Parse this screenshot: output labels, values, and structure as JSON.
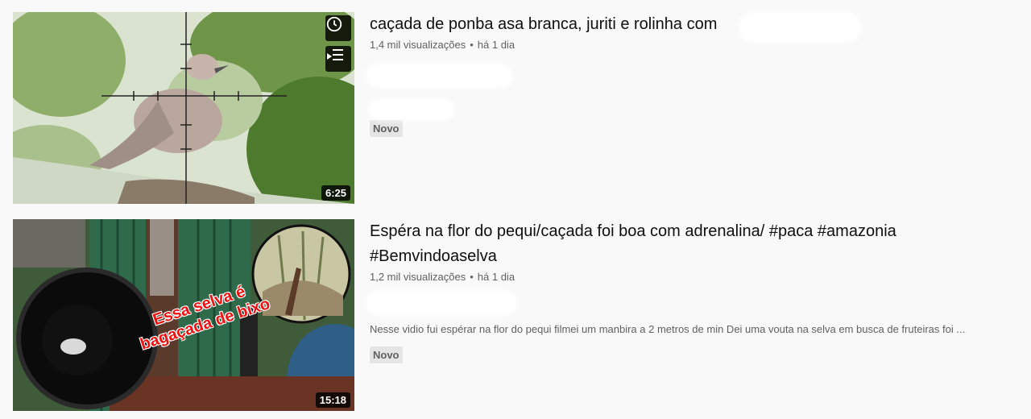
{
  "videos": [
    {
      "title": "caçada de ponba asa branca, juriti e rolinha com",
      "views": "1,4 mil visualizações",
      "age": "há 1 dia",
      "description": "",
      "badge": "Novo",
      "duration": "6:25",
      "hover_icons": [
        "clock-icon",
        "add-to-queue-icon"
      ]
    },
    {
      "title": "Espéra na flor do pequi/caçada foi boa com adrenalina/ #paca #amazonia #Bemvindoaselva",
      "views": "1,2 mil visualizações",
      "age": "há 1 dia",
      "description": "Nesse vidio fui espérar na flor do pequi filmei um manbira a 2 metros de min Dei uma vouta na selva em busca de fruteiras foi ...",
      "badge": "Novo",
      "duration": "15:18",
      "thumbnail_text": "Essa selva é bagaçada de bixo"
    }
  ],
  "separator": "•"
}
